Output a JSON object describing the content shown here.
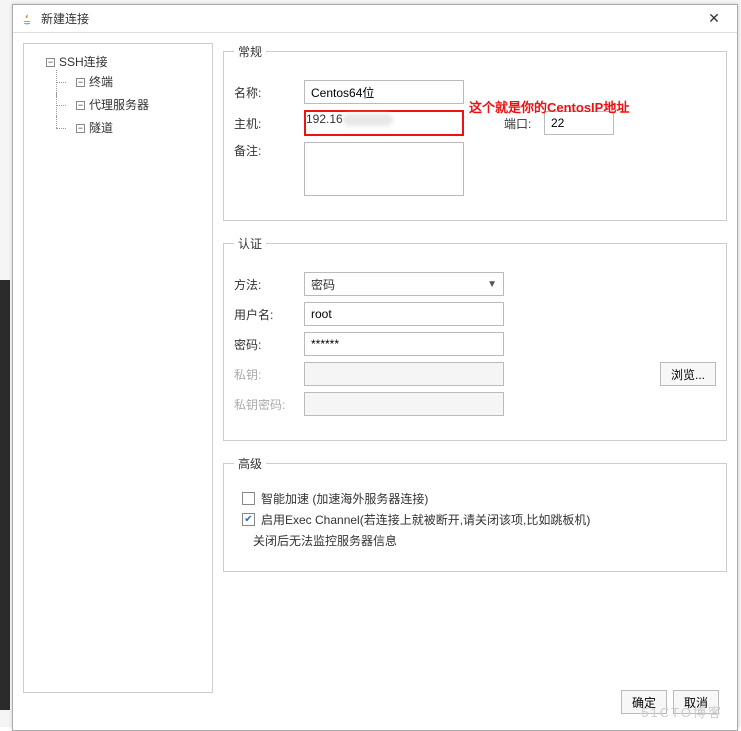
{
  "window": {
    "title": "新建连接"
  },
  "annotation": "这个就是你的CentosIP地址",
  "tree": {
    "root": "SSH连接",
    "items": [
      "终端",
      "代理服务器",
      "隧道"
    ]
  },
  "general": {
    "legend": "常规",
    "name_label": "名称:",
    "name_value": "Centos64位",
    "host_label": "主机:",
    "host_value_prefix": "192.16",
    "port_label": "端口:",
    "port_value": "22",
    "remark_label": "备注:",
    "remark_value": ""
  },
  "auth": {
    "legend": "认证",
    "method_label": "方法:",
    "method_value": "密码",
    "user_label": "用户名:",
    "user_value": "root",
    "password_label": "密码:",
    "password_value": "******",
    "privkey_label": "私钥:",
    "privkey_value": "",
    "privkey_pw_label": "私钥密码:",
    "privkey_pw_value": "",
    "browse_label": "浏览..."
  },
  "advanced": {
    "legend": "高级",
    "accel_label": "智能加速 (加速海外服务器连接)",
    "accel_checked": false,
    "exec_label": "启用Exec Channel(若连接上就被断开,请关闭该项,比如跳板机)",
    "exec_checked": true,
    "exec_note": "关闭后无法监控服务器信息"
  },
  "footer": {
    "ok": "确定",
    "cancel": "取消"
  },
  "watermark": "51CTO博客"
}
